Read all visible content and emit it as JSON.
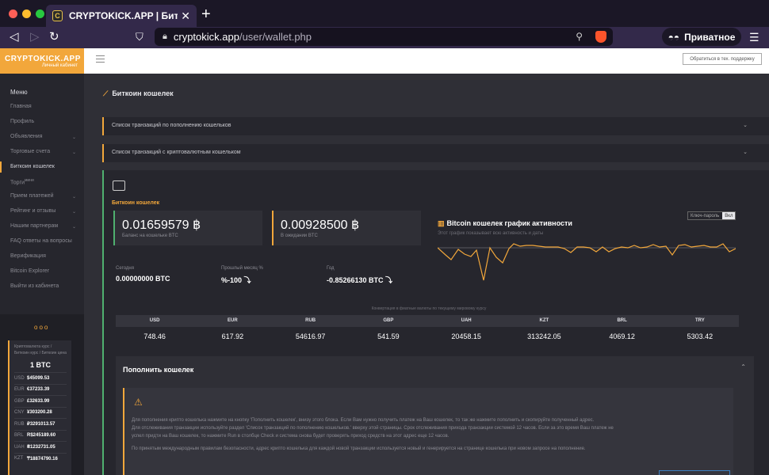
{
  "browser": {
    "tab_title": "CRYPTOKICK.APP | Биткоин кошелек",
    "url_host": "cryptokick.app",
    "url_path": "/user/wallet.php",
    "private_label": "Приватное",
    "colors": {
      "close": "#fe5f57",
      "minimize": "#febc2e",
      "maximize": "#28c840"
    }
  },
  "site": {
    "logo": "CRYPTOKICK.APP",
    "logo_sub": "Личный кабинет",
    "support_button": "Обратиться в тех. поддержку"
  },
  "sidebar": {
    "items": [
      {
        "label": "Меню",
        "type": "menu"
      },
      {
        "label": "Главная"
      },
      {
        "label": "Профиль"
      },
      {
        "label": "Объявления",
        "arrow": true
      },
      {
        "label": "Торговые счета",
        "arrow": true
      },
      {
        "label": "Биткоин кошелек",
        "active": true
      },
      {
        "label": "Торги",
        "sup": "мини"
      },
      {
        "label": "Прием платежей",
        "arrow": true
      },
      {
        "label": "Рейтинг и отзывы",
        "arrow": true
      },
      {
        "label": "Нашим партнерам",
        "arrow": true
      },
      {
        "label": "FAQ ответы на вопросы"
      },
      {
        "label": "Верификация"
      },
      {
        "label": "Bitcoin Explorer"
      },
      {
        "label": "Выйти из кабинета"
      }
    ],
    "rates": {
      "description": "Криптовалюта курс / Биткоин курс / Биткоин цена",
      "unit": "1 BTC",
      "rows": [
        {
          "code": "USD",
          "value": "$45099.53"
        },
        {
          "code": "EUR",
          "value": "€37233.39"
        },
        {
          "code": "GBP",
          "value": "£32633.99"
        },
        {
          "code": "CNY",
          "value": "¥303200.28"
        },
        {
          "code": "RUB",
          "value": "₽3291013.57"
        },
        {
          "code": "BRL",
          "value": "R$245189.60"
        },
        {
          "code": "UAH",
          "value": "₴1232731.05"
        },
        {
          "code": "KZT",
          "value": "₸18874790.16"
        }
      ]
    }
  },
  "page": {
    "title": "Биткоин кошелек",
    "accordions": [
      "Список транзакций по пополнению кошельков",
      "Список транзакций с криптовалютным кошельком"
    ]
  },
  "wallet": {
    "label": "Биткоин кошелек",
    "balance": {
      "value": "0.01659579 ฿",
      "label": "Баланс на кошельке BTC"
    },
    "pending": {
      "value": "0.00928500 ฿",
      "label": "В ожидании BTC"
    },
    "stats": [
      {
        "label": "Сегодня",
        "value": "0.00000000 BTC"
      },
      {
        "label": "Прошлый месяц %",
        "value": "%-100 ⤵"
      },
      {
        "label": "Год",
        "value": "-0.85266130 BTC ⤵"
      }
    ],
    "chart": {
      "title": "Bitcoin кошелек график активности",
      "subtitle": "Этот график показывает всю активность и даты",
      "toggle_label": "Ключ-пароль",
      "toggle_state": "Вкл"
    },
    "conversion_note": "Конвертация в фиатные валюты по текущему мировому курсу",
    "fiat": [
      {
        "code": "USD",
        "value": "748.46"
      },
      {
        "code": "EUR",
        "value": "617.92"
      },
      {
        "code": "RUB",
        "value": "54616.97"
      },
      {
        "code": "GBP",
        "value": "541.59"
      },
      {
        "code": "UAH",
        "value": "20458.15"
      },
      {
        "code": "KZT",
        "value": "313242.05"
      },
      {
        "code": "BRL",
        "value": "4069.12"
      },
      {
        "code": "TRY",
        "value": "5303.42"
      }
    ],
    "topup": {
      "title": "Пополнить кошелек",
      "lines": [
        "Для пополнения крипто кошелька нажмите на кнопку 'Пополнить кошелек', внизу этого блока. Если Вам нужно получить платеж на Ваш кошелек, то так же нажмите пополнить и скопируйте полученный адрес.",
        "Для отслеживания транзакции используйте раздел 'Список транзакций по пополнению кошельков.' вверху этой страницы. Срок отслеживания прихода транзакции системой 12 часов. Если за это время Ваш платеж не",
        "успел придти на Ваш кошелек, то нажмите Run в столбце Check и система снова будет проверять приход средств на этот адрес еще 12 часов.",
        "",
        "По принятым международным правилам безопасности, адрес крипто кошелька для каждой новой транзакции используется новый и генерируется на странице кошелька при новом запросе на пополнение."
      ]
    }
  }
}
